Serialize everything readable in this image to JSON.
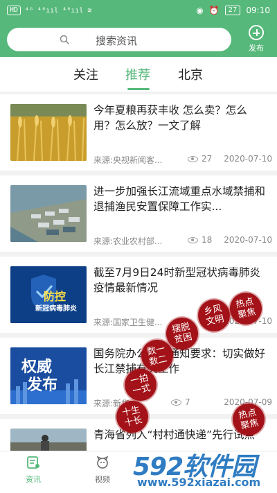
{
  "status_bar": {
    "left_indicators": "HD 4G ⁴⁶ᴵᴵ ⁴⁶ᴵᴵ",
    "battery": "27",
    "time": "09:10"
  },
  "header": {
    "search_placeholder": "搜索资讯",
    "publish_label": "发布",
    "accent_color": "#56b87a"
  },
  "tabs": [
    {
      "label": "关注",
      "active": false
    },
    {
      "label": "推荐",
      "active": true
    },
    {
      "label": "北京",
      "active": false
    }
  ],
  "articles": [
    {
      "title": "今年夏粮再获丰收 怎么卖？怎么用？怎么放？一文了解",
      "source": "来源:央视新闻客...",
      "views": "27",
      "date": "2020-07-10",
      "thumb": "wheat-field"
    },
    {
      "title": "进一步加强长江流域重点水域禁捕和退捕渔民安置保障工作实...",
      "source": "来源:农业农村部...",
      "views": "18",
      "date": "2020-07-10",
      "thumb": "aerial-town"
    },
    {
      "title": "截至7月9日24时新型冠状病毒肺炎疫情最新情况",
      "source": "来源:国家卫生健...",
      "views": "",
      "date": "2020-07-10",
      "thumb": "epidemic-control",
      "thumb_text_1": "防控",
      "thumb_text_2": "新冠病毒肺炎"
    },
    {
      "title": "国务院办公厅发通知要求：切实做好长江禁捕有关工作",
      "source": "来源:新华...",
      "views": "7",
      "date": "2020-07-09",
      "thumb": "authority-release",
      "thumb_text_1": "权威",
      "thumb_text_2": "发布"
    },
    {
      "title": "青海省列入“村村通快递”先行试点",
      "source": "",
      "views": "",
      "date": "",
      "thumb": "road-crowd"
    }
  ],
  "seals": [
    {
      "text": "热点聚焦"
    },
    {
      "text": "乡风文明"
    },
    {
      "text": "摆脱贫困"
    },
    {
      "text": "数一数二"
    },
    {
      "text": "一拍一式"
    },
    {
      "text": "十生十长"
    },
    {
      "text": "热点聚焦"
    }
  ],
  "bottom_nav": [
    {
      "label": "资讯",
      "active": true,
      "icon": "news-icon"
    },
    {
      "label": "视频",
      "active": false,
      "icon": "video-icon"
    }
  ],
  "watermark": {
    "brand": "592软件园",
    "url": "www.592xiazai.com"
  }
}
